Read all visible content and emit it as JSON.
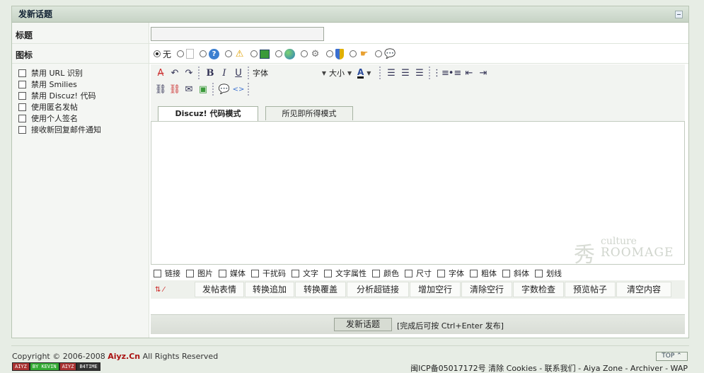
{
  "panel": {
    "title": "发新话题"
  },
  "subject": {
    "label": "标题",
    "value": ""
  },
  "icons": {
    "label": "图标",
    "none_label": "无",
    "items": [
      "blank-page-icon",
      "question-icon",
      "warning-icon",
      "picture-icon",
      "globe-icon",
      "gear-icon",
      "shield-icon",
      "hand-icon",
      "speech-icon"
    ]
  },
  "options": [
    "禁用 URL 识别",
    "禁用 Smilies",
    "禁用 Discuz! 代码",
    "使用匿名发帖",
    "使用个人签名",
    "接收新回复邮件通知"
  ],
  "editor": {
    "font_select": "字体",
    "size_select": "大小",
    "tab_code": "Discuz! 代码模式",
    "tab_wysiwyg": "所见即所得模式",
    "watermark_small": "culture",
    "watermark_big": "ROOMAGE",
    "watermark_char": "秀"
  },
  "discuz_codes": [
    "链接",
    "图片",
    "媒体",
    "干扰码",
    "文字",
    "文字属性",
    "颜色",
    "尺寸",
    "字体",
    "粗体",
    "斜体",
    "划线"
  ],
  "actions": [
    "发帖表情",
    "转换追加",
    "转换覆盖",
    "分析超链接",
    "增加空行",
    "清除空行",
    "字数检查",
    "预览帖子",
    "清空内容"
  ],
  "submit": {
    "label": "发新话题",
    "hint": "[完成后可按 Ctrl+Enter 发布]"
  },
  "footer": {
    "copyright_prefix": "Copyright © 2006-2008 ",
    "brand": "Aiyz.Cn",
    "copyright_suffix": " All Rights Reserved",
    "badges": [
      "AIYZ",
      "BY KEVIN",
      "AIYZ",
      "B4TIME"
    ],
    "top": "TOP ⌃",
    "links": "闽ICP备05017172号   清除 Cookies - 联系我们 - Aiya Zone - Archiver - WAP"
  }
}
